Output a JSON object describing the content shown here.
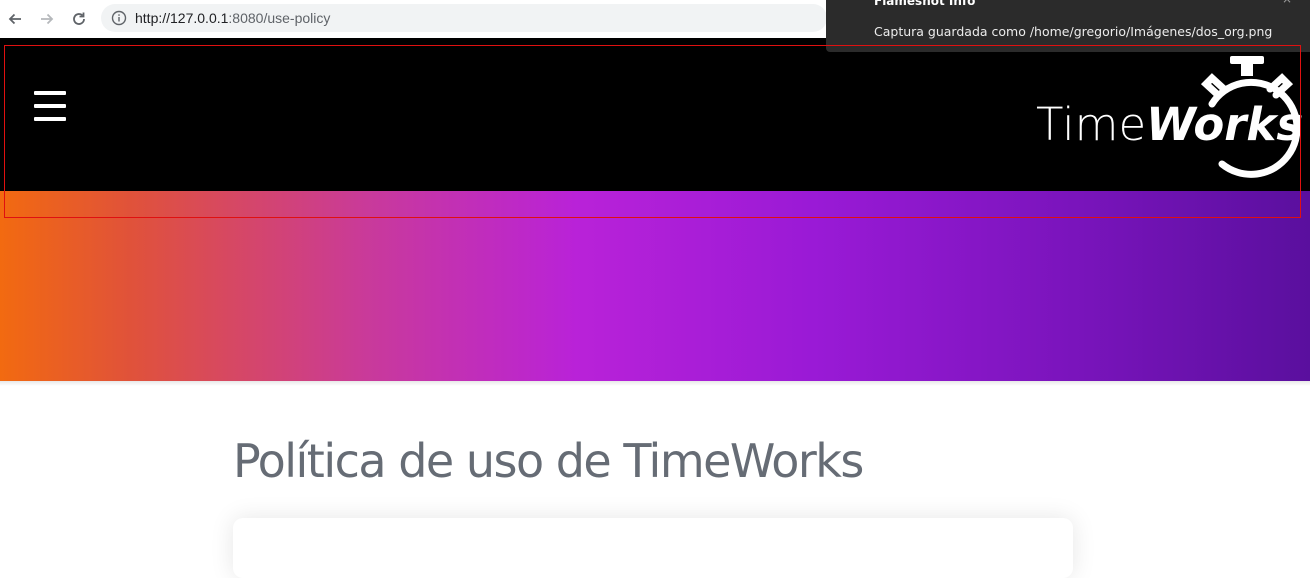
{
  "browser": {
    "url_host": "http://127.0.0.1",
    "url_rest": ":8080/use-policy"
  },
  "notification": {
    "title": "Flameshot Info",
    "message": "Captura guardada como /home/gregorio/Imágenes/dos_org.png",
    "close": "×"
  },
  "header": {
    "logo_plain": "Time",
    "logo_italic": "Works"
  },
  "page": {
    "title": "Política de uso de TimeWorks"
  },
  "colors": {
    "header_bg": "#000000",
    "gradient_start": "#f26a10",
    "gradient_mid": "#b922d8",
    "gradient_end": "#5a0f9e",
    "title_color": "#666c75",
    "highlight": "#e01010"
  }
}
